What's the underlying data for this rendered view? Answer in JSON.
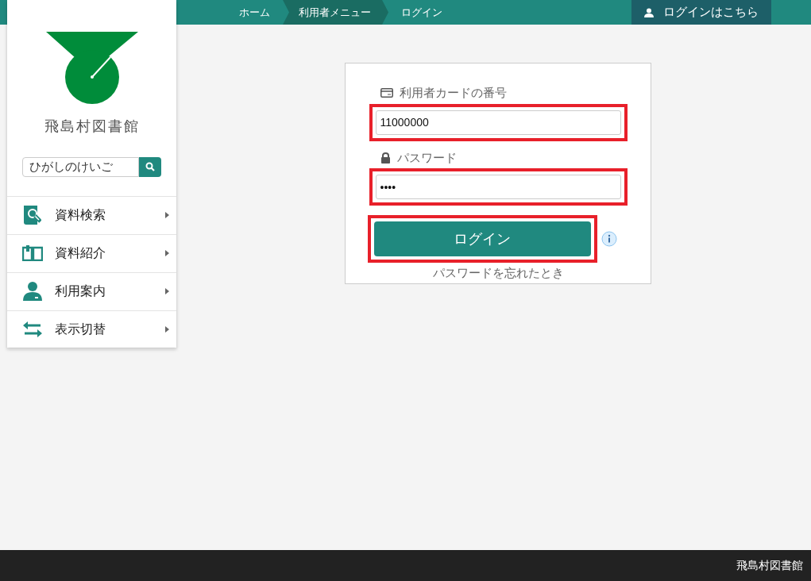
{
  "breadcrumb": [
    {
      "label": "ホーム",
      "selected": false
    },
    {
      "label": "利用者メニュー",
      "selected": true
    },
    {
      "label": "ログイン",
      "selected": false
    }
  ],
  "login_link": {
    "label": "ログインはこちら"
  },
  "sidebar": {
    "library_name": "飛島村図書館",
    "search": {
      "value": "ひがしのけいご"
    },
    "items": [
      {
        "kind": "search",
        "label": "資料検索"
      },
      {
        "kind": "book",
        "label": "資料紹介"
      },
      {
        "kind": "person",
        "label": "利用案内"
      },
      {
        "kind": "switch",
        "label": "表示切替"
      }
    ]
  },
  "form": {
    "fields": [
      {
        "kind": "card",
        "label": "利用者カードの番号",
        "value": "11000000",
        "highlighted": true
      },
      {
        "kind": "lock",
        "label": "パスワード",
        "value": "••••",
        "highlighted": true
      }
    ],
    "submit": {
      "label": "ログイン",
      "highlighted": true
    },
    "forgot_link": "パスワードを忘れたとき"
  },
  "footer": {
    "text": "飛島村図書館"
  }
}
